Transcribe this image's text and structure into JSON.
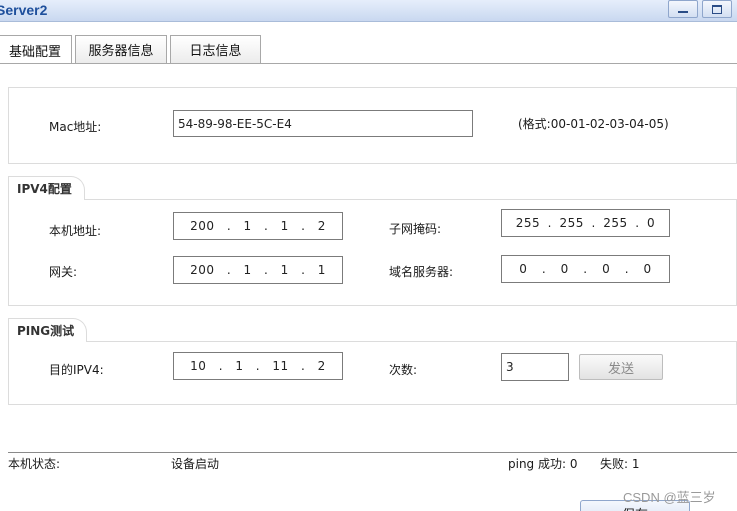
{
  "window": {
    "title": "Server2"
  },
  "tabs": [
    {
      "label": "基础配置",
      "active": true
    },
    {
      "label": "服务器信息",
      "active": false
    },
    {
      "label": "日志信息",
      "active": false
    }
  ],
  "mac": {
    "label": "Mac地址:",
    "value": "54-89-98-EE-5C-E4",
    "format_hint": "(格式:00-01-02-03-04-05)"
  },
  "ipv4": {
    "section_title": "IPV4配置",
    "local_address": {
      "label": "本机地址:",
      "octets": [
        "200",
        "1",
        "1",
        "2"
      ]
    },
    "subnet_mask": {
      "label": "子网掩码:",
      "octets": [
        "255",
        "255",
        "255",
        "0"
      ]
    },
    "gateway": {
      "label": "网关:",
      "octets": [
        "200",
        "1",
        "1",
        "1"
      ]
    },
    "dns_server": {
      "label": "域名服务器:",
      "octets": [
        "0",
        "0",
        "0",
        "0"
      ]
    }
  },
  "ping": {
    "section_title": "PING测试",
    "target": {
      "label": "目的IPV4:",
      "octets": [
        "10",
        "1",
        "11",
        "2"
      ]
    },
    "count": {
      "label": "次数:",
      "value": "3"
    },
    "send_label": "发送"
  },
  "status": {
    "label": "本机状态:",
    "value": "设备启动",
    "ping_success": "ping 成功: 0",
    "ping_fail": "失败: 1"
  },
  "save_label": "保存",
  "watermark": "CSDN @蓝三岁",
  "colors": {
    "title": "#1e4f9c",
    "titlebar": "#c9d8f0",
    "border": "#dcdcdc"
  }
}
